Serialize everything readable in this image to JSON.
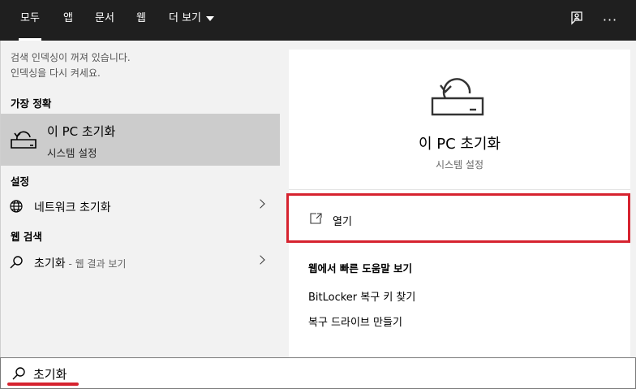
{
  "tabs": [
    {
      "label": "모두"
    },
    {
      "label": "앱"
    },
    {
      "label": "문서"
    },
    {
      "label": "웹"
    },
    {
      "label": "더 보기"
    }
  ],
  "topbar": {
    "feedback_icon": "feedback-icon",
    "more_icon": "ellipsis-icon",
    "more_glyph": "···"
  },
  "left": {
    "notice_line1": "검색 인덱싱이 꺼져 있습니다.",
    "notice_line2": "인덱싱을 다시 켜세요.",
    "best_match_heading": "가장 정확",
    "best_match": {
      "title": "이 PC 초기화",
      "subtitle": "시스템 설정",
      "icon": "reset-pc-icon"
    },
    "settings_heading": "설정",
    "settings_item": {
      "label": "네트워크 초기화",
      "icon": "globe-icon"
    },
    "web_heading": "웹 검색",
    "web_item": {
      "label": "초기화",
      "suffix": " - 웹 결과 보기",
      "icon": "search-icon"
    }
  },
  "right": {
    "title": "이 PC 초기화",
    "subtitle": "시스템 설정",
    "open_label": "열기",
    "help_heading": "웹에서 빠른 도움말 보기",
    "help_links": [
      "BitLocker 복구 키 찾기",
      "복구 드라이브 만들기"
    ]
  },
  "search": {
    "value": "초기화"
  },
  "colors": {
    "topbar": "#1f1f1f",
    "highlight": "#cccccc",
    "annotation_red": "#d6232f",
    "panel_bg": "#f2f2f2"
  }
}
